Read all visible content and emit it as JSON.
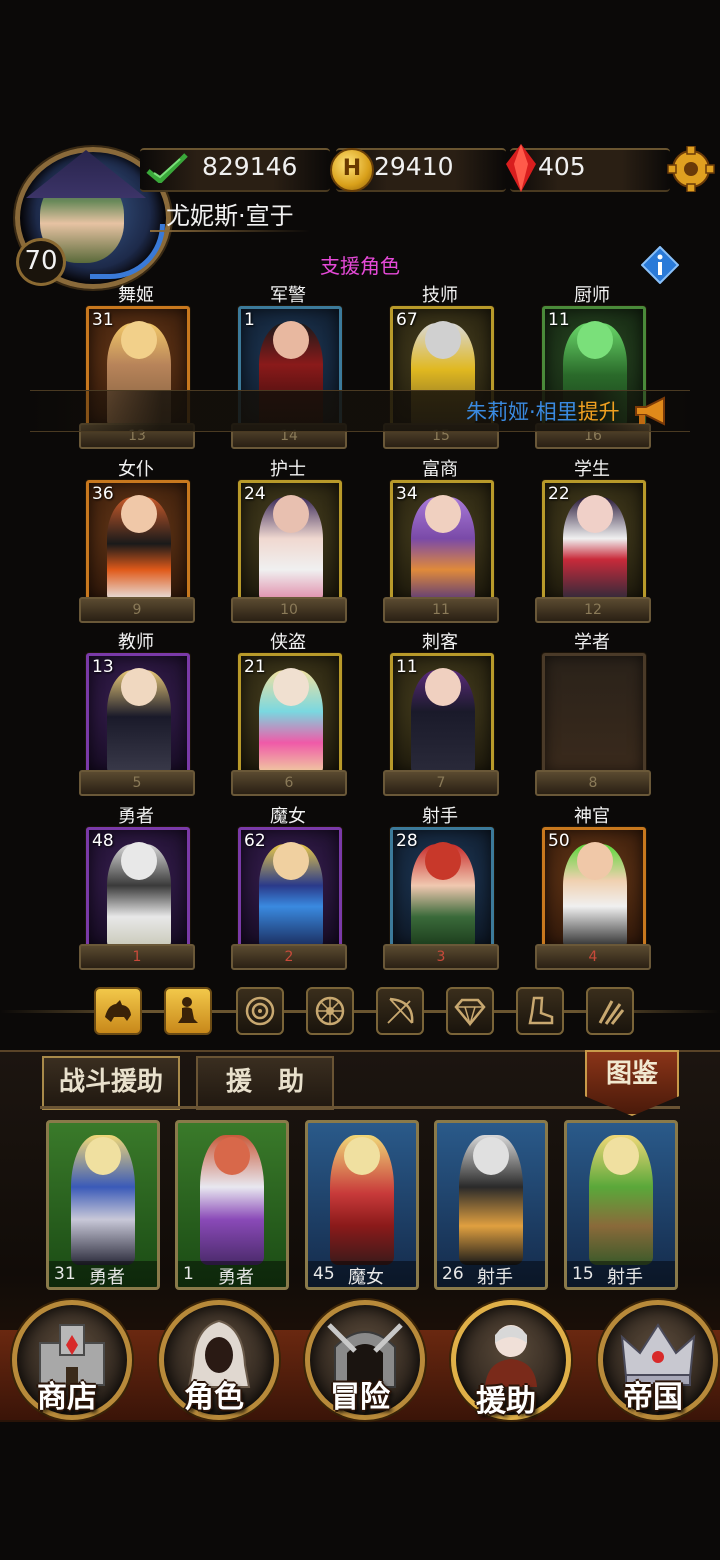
{
  "header": {
    "player_level": "70",
    "power": "829146",
    "gold": "29410",
    "gold_icon_letter": "H",
    "gems": "405",
    "player_name": "尤妮斯·宣于",
    "icons": [
      "check-icon",
      "gold-coin-icon",
      "red-gem-icon",
      "settings-gear-icon",
      "info-icon"
    ]
  },
  "section_title": "支援角色",
  "announcement": {
    "name": "朱莉娅·相里",
    "action": "提升",
    "name_color": "#3a8ae0",
    "action_color": "#f0a020"
  },
  "roles": [
    {
      "name": "舞姬",
      "level": "31",
      "slot": "13",
      "frame": "orange"
    },
    {
      "name": "军警",
      "level": "1",
      "slot": "14",
      "frame": "blue"
    },
    {
      "name": "技师",
      "level": "67",
      "slot": "15",
      "frame": "gold"
    },
    {
      "name": "厨师",
      "level": "11",
      "slot": "16",
      "frame": "green"
    },
    {
      "name": "女仆",
      "level": "36",
      "slot": "9",
      "frame": "orange"
    },
    {
      "name": "护士",
      "level": "24",
      "slot": "10",
      "frame": "gold"
    },
    {
      "name": "富商",
      "level": "34",
      "slot": "11",
      "frame": "gold"
    },
    {
      "name": "学生",
      "level": "22",
      "slot": "12",
      "frame": "gold"
    },
    {
      "name": "教师",
      "level": "13",
      "slot": "5",
      "frame": "purple"
    },
    {
      "name": "侠盗",
      "level": "21",
      "slot": "6",
      "frame": "gold"
    },
    {
      "name": "刺客",
      "level": "11",
      "slot": "7",
      "frame": "gold"
    },
    {
      "name": "学者",
      "level": "",
      "slot": "8",
      "frame": "empty"
    },
    {
      "name": "勇者",
      "level": "48",
      "slot": "1",
      "frame": "purple"
    },
    {
      "name": "魔女",
      "level": "62",
      "slot": "2",
      "frame": "purple"
    },
    {
      "name": "射手",
      "level": "28",
      "slot": "3",
      "frame": "blue"
    },
    {
      "name": "神官",
      "level": "50",
      "slot": "4",
      "frame": "orange"
    }
  ],
  "filters": [
    {
      "icon": "beast-icon",
      "active": true
    },
    {
      "icon": "woman-silhouette-icon",
      "active": true
    },
    {
      "icon": "target-icon",
      "active": false
    },
    {
      "icon": "wheel-icon",
      "active": false
    },
    {
      "icon": "bow-icon",
      "active": false
    },
    {
      "icon": "diamond-icon",
      "active": false
    },
    {
      "icon": "boot-icon",
      "active": false
    },
    {
      "icon": "claw-icon",
      "active": false
    }
  ],
  "tabs": {
    "battle_support": "战斗援助",
    "support": "援　助",
    "catalog": "图鉴"
  },
  "support_cards": [
    {
      "level": "31",
      "class": "勇者",
      "bg": "green"
    },
    {
      "level": "1",
      "class": "勇者",
      "bg": "green"
    },
    {
      "level": "45",
      "class": "魔女",
      "bg": "blue"
    },
    {
      "level": "26",
      "class": "射手",
      "bg": "blue"
    },
    {
      "level": "15",
      "class": "射手",
      "bg": "blue"
    }
  ],
  "nav": {
    "shop": "商店",
    "character": "角色",
    "adventure": "冒险",
    "support": "援助",
    "empire": "帝国"
  }
}
